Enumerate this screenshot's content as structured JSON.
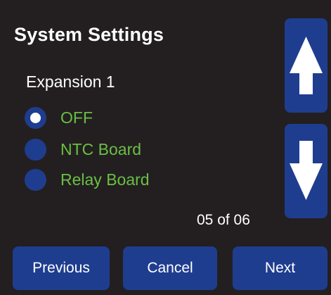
{
  "header": {
    "title": "System Settings",
    "subtitle": "Expansion 1"
  },
  "options": [
    {
      "label": "OFF",
      "selected": true
    },
    {
      "label": "NTC Board",
      "selected": false
    },
    {
      "label": "Relay Board",
      "selected": false
    }
  ],
  "pagination": {
    "text": "05 of 06"
  },
  "scroll": {
    "up_icon": "arrow-up-icon",
    "down_icon": "arrow-down-icon"
  },
  "footer": {
    "previous_label": "Previous",
    "cancel_label": "Cancel",
    "next_label": "Next"
  },
  "colors": {
    "background": "#231f20",
    "button": "#1f3d8f",
    "option_text": "#6abf45",
    "text": "#ffffff"
  }
}
